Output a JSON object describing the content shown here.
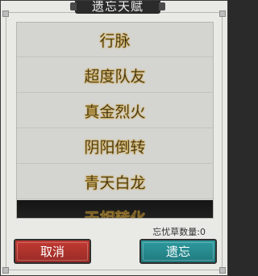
{
  "dialog": {
    "title": "遗忘天赋"
  },
  "talents": [
    {
      "name": "行脉"
    },
    {
      "name": "超度队友"
    },
    {
      "name": "真金烈火"
    },
    {
      "name": "阴阳倒转"
    },
    {
      "name": "青天白龙"
    },
    {
      "name": "天相转化"
    }
  ],
  "counter": {
    "label": "忘忧草数量:",
    "value": "0"
  },
  "buttons": {
    "cancel": "取消",
    "forget": "遗忘"
  },
  "colors": {
    "cancel": "#b3332e",
    "forget": "#2a8d92",
    "title_bg": "#2b2b2b"
  }
}
